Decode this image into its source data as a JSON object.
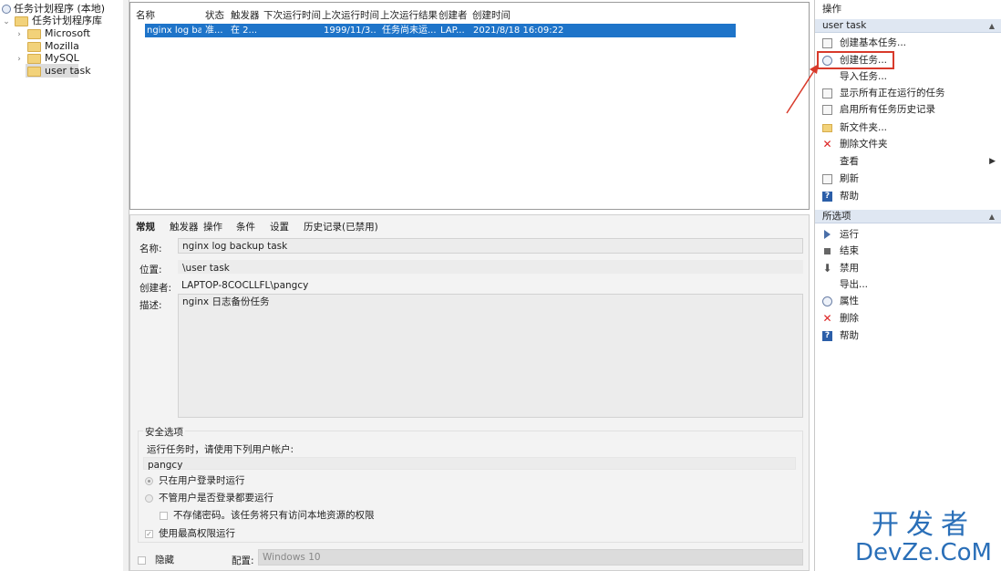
{
  "tree": {
    "root": "任务计划程序 (本地)",
    "library": "任务计划程序库",
    "children": [
      "Microsoft",
      "Mozilla",
      "MySQL",
      "user task"
    ]
  },
  "task_list": {
    "columns": [
      "名称",
      "状态",
      "触发器",
      "下次运行时间",
      "上次运行时间",
      "上次运行结果",
      "创建者",
      "创建时间"
    ],
    "selected_row": [
      "nginx log ba...",
      "准...",
      "在 2...",
      "",
      "1999/11/3...",
      "任务尚未运...",
      "LAP...",
      "2021/8/18 16:09:22"
    ]
  },
  "details": {
    "tabs": [
      "常规",
      "触发器",
      "操作",
      "条件",
      "设置",
      "历史记录(已禁用)"
    ],
    "name_label": "名称:",
    "name_value": "nginx log backup task",
    "location_label": "位置:",
    "location_value": "\\user task",
    "author_label": "创建者:",
    "author_value": "LAPTOP-8COCLLFL\\pangcy",
    "desc_label": "描述:",
    "desc_value": "nginx 日志备份任务",
    "security": {
      "title": "安全选项",
      "run_as_text": "运行任务时，请使用下列用户帐户:",
      "user": "pangcy",
      "opt1": "只在用户登录时运行",
      "opt2": "不管用户是否登录都要运行",
      "no_store_pw": "不存储密码。该任务将只有访问本地资源的权限",
      "highest": "使用最高权限运行"
    },
    "hidden_label": "隐藏",
    "config_label": "配置:",
    "config_value": "Windows 10"
  },
  "actions": {
    "header": "操作",
    "section1": "user task",
    "items1": [
      "创建基本任务...",
      "创建任务...",
      "导入任务...",
      "显示所有正在运行的任务",
      "启用所有任务历史记录",
      "新文件夹...",
      "删除文件夹",
      "查看",
      "刷新",
      "帮助"
    ],
    "section2": "所选项",
    "items2": [
      "运行",
      "结束",
      "禁用",
      "导出...",
      "属性",
      "删除",
      "帮助"
    ]
  },
  "watermark": {
    "line1": "开发者",
    "line2": "DevZe.CoM"
  },
  "colors": {
    "selection": "#1e74c9",
    "highlight": "#d83a2b",
    "section_blue": "#dfe7f2"
  }
}
